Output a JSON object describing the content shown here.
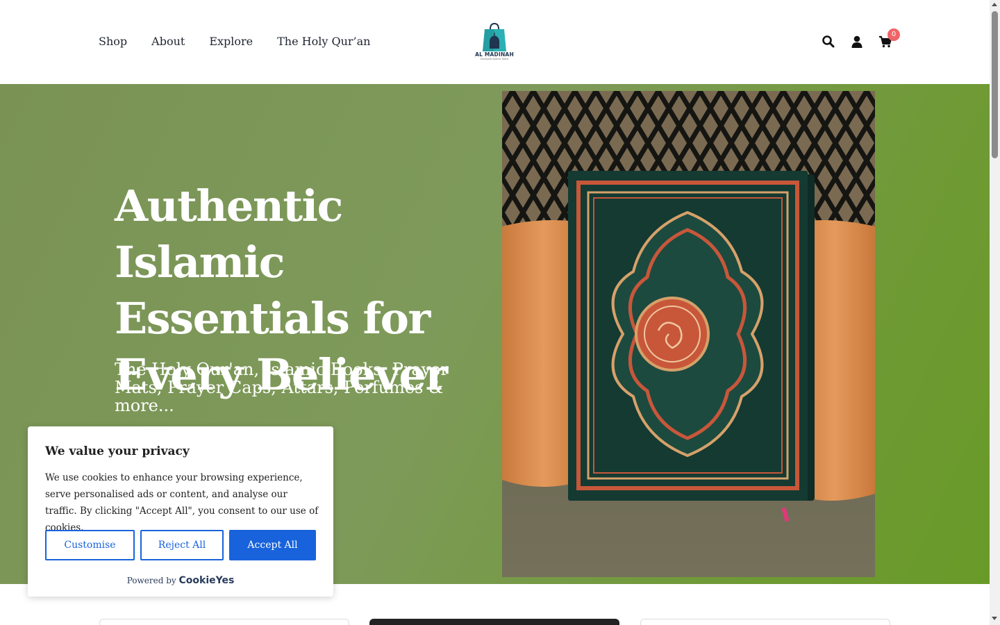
{
  "header": {
    "nav": [
      "Shop",
      "About",
      "Explore",
      "The Holy Qur’an"
    ],
    "logo": {
      "name": "AL MADINAH",
      "tagline": "Exclusive Islamic Store"
    },
    "icons": [
      "search-icon",
      "user-icon",
      "cart-icon"
    ],
    "cart_count": "0"
  },
  "hero": {
    "title": "Authentic Islamic Essentials for Every Believer",
    "subtitle": "The Holy Qur'an, Islamic Books, Prayer Mats, Prayer Caps, Attars, Perfumes & more...",
    "image": "quran-book-image"
  },
  "cookie": {
    "title": "We value your privacy",
    "text": "We use cookies to enhance your browsing experience, serve personalised ads or content, and analyse our traffic. By clicking \"Accept All\", you consent to our use of cookies.",
    "buttons": {
      "customise": "Customise",
      "reject": "Reject All",
      "accept": "Accept All"
    },
    "powered_by": "Powered by",
    "brand": "CookieYes"
  },
  "colors": {
    "hero_bg": "#7e9a5a",
    "accent_blue": "#1863dc",
    "badge": "#f06467"
  }
}
